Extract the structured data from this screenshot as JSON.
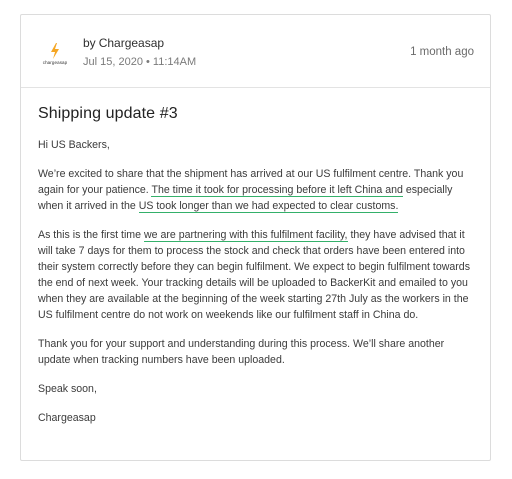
{
  "author": {
    "prefix": "by",
    "name": "Chargeasap",
    "logo_text": "chargeasap"
  },
  "post": {
    "date": "Jul 15, 2020 • 11:14AM",
    "relative_time": "1 month ago",
    "title": "Shipping update #3",
    "greeting": "Hi US Backers,",
    "p1_a": "We’re excited to share that the shipment has arrived at our US fulfilment centre. Thank you again for your patience. ",
    "p1_hl1": "The time it took for processing before it left China and",
    "p1_b": " especially when it arrived in the ",
    "p1_hl2": "US took longer than we had expected to clear customs.",
    "p2_a": "As this is the first time ",
    "p2_hl": "we are partnering with this fulfilment facility,",
    "p2_b": " they have advised that it will take 7 days for them to process the stock and check that orders have been entered into their system correctly before they can begin fulfilment. We expect to begin fulfilment towards the end of next week. Your tracking details will be uploaded to BackerKit and emailed to you when they are available at the beginning of the week starting 27th July as the workers in the US fulfilment centre do not work on weekends like our fulfilment staff in China do.",
    "p3": "Thank you for your support and understanding during this process. We’ll share another update when tracking numbers have been uploaded.",
    "signoff": "Speak soon,",
    "signature": "Chargeasap"
  },
  "colors": {
    "highlight_underline": "#34b06a",
    "logo_bolt": "#f5a623",
    "border": "#dcdcdc"
  },
  "icons": {
    "logo": "lightning-bolt-icon"
  }
}
